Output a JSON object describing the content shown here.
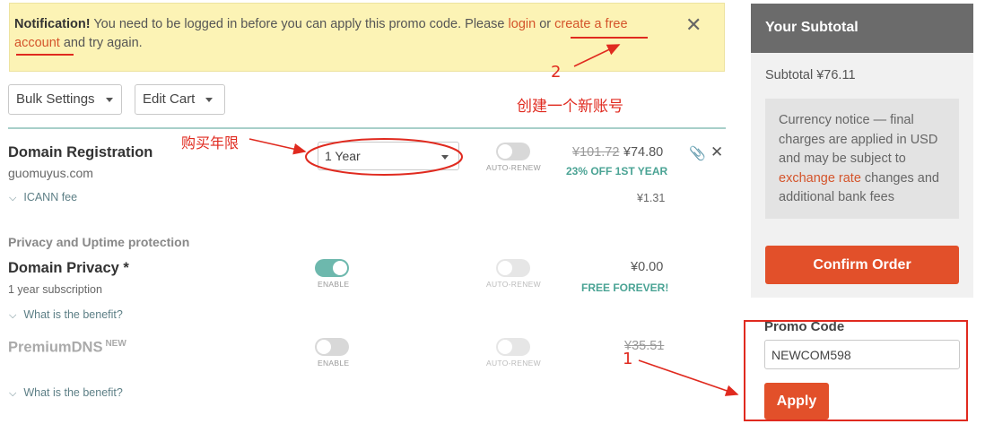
{
  "notification": {
    "prefix": "Notification!",
    "text1": " You need to be logged in before you can apply this promo code. Please ",
    "login": "login",
    "text2": " or ",
    "create_account": "create a free account",
    "text3": " and try again.",
    "close": "✕"
  },
  "toolbar": {
    "bulk_settings": "Bulk Settings",
    "edit_cart": "Edit Cart"
  },
  "domain_registration": {
    "title": "Domain Registration",
    "domain": "guomuyus.com",
    "term": "1 Year",
    "auto_renew_label": "AUTO-RENEW",
    "old_price": "¥101.72",
    "price": "¥74.80",
    "discount": "23% OFF 1ST YEAR",
    "icann_label": "ICANN fee",
    "icann_price": "¥1.31"
  },
  "privacy_section": {
    "heading": "Privacy and Uptime protection",
    "privacy_title": "Domain Privacy *",
    "privacy_sub": "1 year subscription",
    "enable_label": "ENABLE",
    "auto_renew_label": "AUTO-RENEW",
    "privacy_price": "¥0.00",
    "privacy_note": "FREE FOREVER!",
    "benefit_link": "What is the benefit?",
    "premium_title": "PremiumDNS",
    "premium_badge": "NEW",
    "premium_enable_label": "ENABLE",
    "premium_auto_label": "AUTO-RENEW",
    "premium_old_price": "¥35.51",
    "premium_benefit_link": "What is the benefit?"
  },
  "sidebar": {
    "title": "Your Subtotal",
    "subtotal": "Subtotal ¥76.11",
    "currency_text1": "Currency notice — final charges are applied in USD and may be subject to ",
    "currency_link": "exchange rate",
    "currency_text2": " changes and additional bank fees",
    "confirm": "Confirm Order"
  },
  "promo": {
    "label": "Promo Code",
    "value": "NEWCOM598",
    "apply": "Apply"
  },
  "annotations": {
    "buy_term": "购买年限",
    "num_2": "2",
    "create_new_account": "创建一个新账号",
    "num_1": "1"
  },
  "colors": {
    "accent": "#e2502a",
    "annotation": "#e02a1f",
    "teal": "#6db8ad",
    "notice_bg": "#fcf3b5"
  }
}
